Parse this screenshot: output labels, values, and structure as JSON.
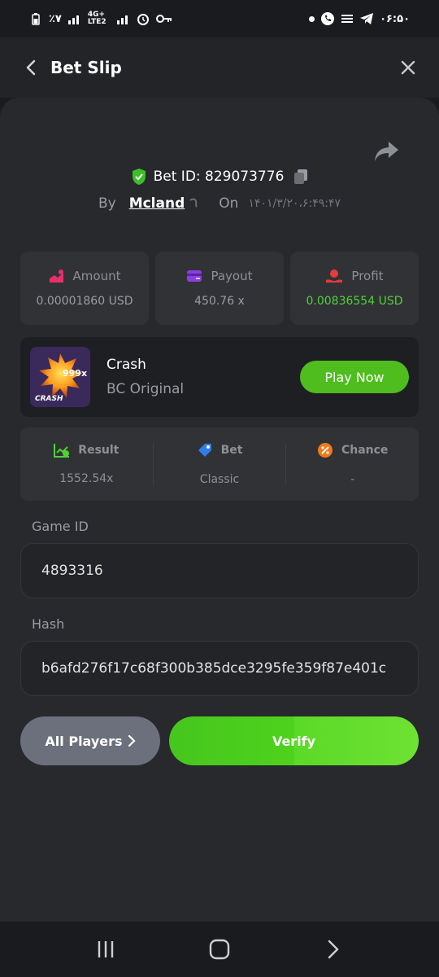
{
  "status_bar": {
    "left_text": "٪۷",
    "network": "4G+ LTE2",
    "time": "۰۶:۵۰"
  },
  "header": {
    "title": "Bet Slip"
  },
  "bet": {
    "id_label": "Bet ID: 829073776",
    "by_label": "By",
    "user": "Mcland",
    "on_label": "On",
    "date": "۱۴۰۱/۳/۲۰،۶:۴۹:۴۷"
  },
  "stats": [
    {
      "label": "Amount",
      "value": "0.00001860 USD",
      "icon": "amount-icon"
    },
    {
      "label": "Payout",
      "value": "450.76 x",
      "icon": "payout-icon"
    },
    {
      "label": "Profit",
      "value": "0.00836554 USD",
      "icon": "profit-icon"
    }
  ],
  "game": {
    "name": "Crash",
    "subtitle": "BC Original",
    "thumb_badge": "999x",
    "thumb_title": "CRASH",
    "play_label": "Play Now"
  },
  "results": [
    {
      "label": "Result",
      "value": "1552.54x",
      "icon": "result-icon"
    },
    {
      "label": "Bet",
      "value": "Classic",
      "icon": "bet-tag-icon"
    },
    {
      "label": "Chance",
      "value": "-",
      "icon": "percent-icon"
    }
  ],
  "fields": {
    "game_id_label": "Game ID",
    "game_id_value": "4893316",
    "hash_label": "Hash",
    "hash_value": "b6afd276f17c68f300b385dce3295fe359f87e401c"
  },
  "buttons": {
    "all_players": "All Players",
    "verify": "Verify"
  },
  "colors": {
    "accent_green": "#4fbd1e",
    "profit_green": "#4ed236",
    "panel": "#28292d"
  }
}
